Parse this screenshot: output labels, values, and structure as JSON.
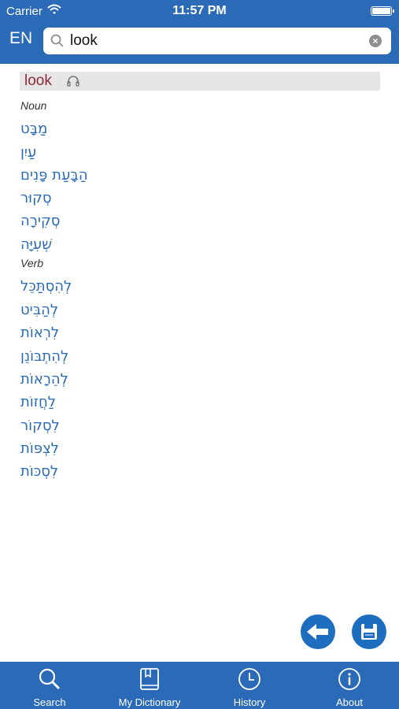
{
  "status": {
    "carrier": "Carrier",
    "time": "11:57 PM"
  },
  "header": {
    "lang": "EN"
  },
  "search": {
    "value": "look",
    "placeholder": ""
  },
  "entry": {
    "word": "look",
    "sections": [
      {
        "pos": "Noun",
        "translations": [
          "מַבָּט",
          "עַיִן",
          "הַבָּעַת פָּנִים",
          "סְקוּר",
          "סְקִירָה",
          "שְׁעִיָּה"
        ]
      },
      {
        "pos": "Verb",
        "translations": [
          "לְהִסְתַּכֵּל",
          "לְהַבִּיט",
          "לִרְאוֹת",
          "לְהִתְבּוֹנֵן",
          "לְהֵרָאוֹת",
          "לַחֲזוֹת",
          "לִסְקוֹר",
          "לִצְפּוֹת",
          "לִסְכּוֹת"
        ]
      }
    ]
  },
  "tabs": [
    {
      "label": "Search",
      "icon": "search-icon"
    },
    {
      "label": "My Dictionary",
      "icon": "book-icon"
    },
    {
      "label": "History",
      "icon": "clock-icon"
    },
    {
      "label": "About",
      "icon": "info-icon"
    }
  ],
  "colors": {
    "primary": "#2a6ab6",
    "word": "#8a2b3a",
    "translation": "#2a6ab6"
  }
}
